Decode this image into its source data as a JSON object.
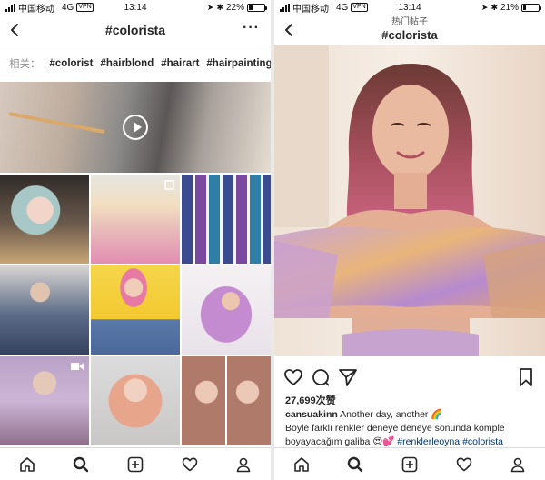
{
  "left": {
    "status": {
      "carrier": "中国移动",
      "network": "4G",
      "vpn": "VPN",
      "time": "13:14",
      "battery": "22%",
      "battery_level": 0.22
    },
    "nav": {
      "title": "#colorista",
      "more": "···"
    },
    "related": {
      "label": "相关：",
      "tags": [
        "#colorist",
        "#hairblond",
        "#hairart",
        "#hairpainting"
      ]
    }
  },
  "right": {
    "status": {
      "carrier": "中国移动",
      "network": "4G",
      "vpn": "VPN",
      "time": "13:14",
      "battery": "21%",
      "battery_level": 0.21
    },
    "nav": {
      "subtitle": "热门帖子",
      "title": "#colorista"
    },
    "post": {
      "likes": "27,699次赞",
      "username": "cansuakinn",
      "caption_lines": [
        " Another day, another ",
        "Böyle farklı renkler deneye deneye sonunda komple boyayacağım galiba "
      ],
      "emoji_1": "🌈",
      "emoji_2": "😍💕",
      "hashtags": [
        "#renklerleoyna",
        "#colorista"
      ]
    }
  },
  "colors": {
    "accent": "#003569",
    "border": "#dbdbdb",
    "text": "#262626",
    "muted": "#8e8e8e"
  }
}
